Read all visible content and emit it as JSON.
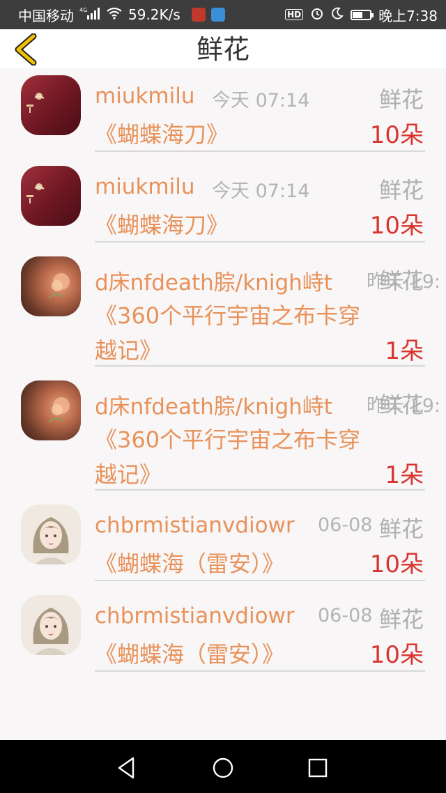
{
  "status_bar": {
    "carrier": "中国移动",
    "network": "4G",
    "speed": "59.2K/s",
    "hd": "HD",
    "time": "晚上7:38",
    "battery_percent": 55,
    "icons": [
      "signal-icon",
      "wifi-icon",
      "app-badge-icon",
      "app-badge-icon",
      "hd-icon",
      "alarm-icon",
      "moon-icon",
      "battery-icon"
    ]
  },
  "header": {
    "title": "鲜花",
    "back_icon": "chevron-left-icon",
    "accent": "#e8b400"
  },
  "items": [
    {
      "name": "miukmilu",
      "time": "今天 07:14",
      "type": "鲜花",
      "book": "《蝴蝶海刀》",
      "qty": "10朵",
      "avatar": "dark-red-avatar"
    },
    {
      "name": "miukmilu",
      "time": "今天 07:14",
      "type": "鲜花",
      "book": "《蝴蝶海刀》",
      "qty": "10朵",
      "avatar": "dark-red-avatar"
    },
    {
      "name": "d床nfdeath腙/knigh峙t",
      "time": "昨天 19:",
      "type": "鲜花",
      "book": "《360个平行宇宙之布卡穿越记》",
      "qty": "1朵",
      "avatar": "flower-avatar"
    },
    {
      "name": "d床nfdeath腙/knigh峙t",
      "time": "昨天 19:",
      "type": "鲜花",
      "book": "《360个平行宇宙之布卡穿越记》",
      "qty": "1朵",
      "avatar": "flower-avatar"
    },
    {
      "name": "chbrmistianvdiowr",
      "time": "06-08",
      "type": "鲜花",
      "book": "《蝴蝶海（雷安）》",
      "qty": "10朵",
      "avatar": "girl-avatar"
    },
    {
      "name": "chbrmistianvdiowr",
      "time": "06-08",
      "type": "鲜花",
      "book": "《蝴蝶海（雷安）》",
      "qty": "10朵",
      "avatar": "girl-avatar"
    }
  ],
  "nav_bar": {
    "icons": [
      "back-triangle-icon",
      "home-circle-icon",
      "recents-square-icon"
    ]
  },
  "colors": {
    "name": "#e8925a",
    "qty": "#d9352f",
    "muted": "#b4b4b4"
  }
}
